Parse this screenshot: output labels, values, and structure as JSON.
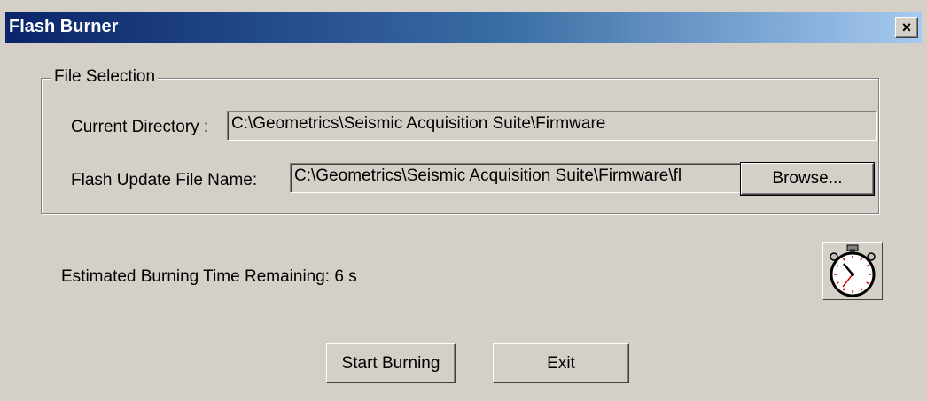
{
  "window": {
    "title": "Flash Burner",
    "close_label": "×"
  },
  "file_selection": {
    "legend": "File Selection",
    "current_directory_label": "Current Directory :",
    "current_directory_value": "C:\\Geometrics\\Seismic Acquisition Suite\\Firmware",
    "flash_update_label": "Flash Update File Name:",
    "flash_update_value": "C:\\Geometrics\\Seismic Acquisition Suite\\Firmware\\fl",
    "browse_label": "Browse..."
  },
  "status": {
    "estimated_time_text": "Estimated Burning Time Remaining: 6 s"
  },
  "buttons": {
    "start_label": "Start Burning",
    "exit_label": "Exit"
  },
  "icons": {
    "stopwatch": "stopwatch-icon",
    "close": "close-icon"
  },
  "colors": {
    "titlebar_start": "#0a246a",
    "titlebar_end": "#a6caf0",
    "dialog_bg": "#d4d0c8"
  }
}
